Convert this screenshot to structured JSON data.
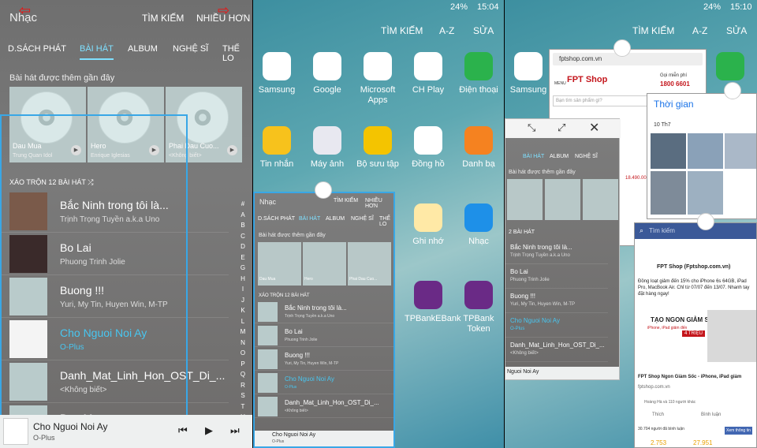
{
  "panel1": {
    "title": "Nhạc",
    "actions": [
      "TÌM KIẾM",
      "NHIỀU HƠN"
    ],
    "tabs": [
      "D.SÁCH PHÁT",
      "BÀI HÁT",
      "ALBUM",
      "NGHỆ SĨ",
      "THỂ LO"
    ],
    "recent_label": "Bài hát được thêm gần đây",
    "albums": [
      {
        "title": "Dau Mua",
        "sub": "Trung Quan Idol"
      },
      {
        "title": "Hero",
        "sub": "Enrique Iglesias"
      },
      {
        "title": "Phai Dau Cuo...",
        "sub": "<Không biết>"
      }
    ],
    "shuffle": "XÁO TRỘN 12 BÀI HÁT",
    "songs": [
      {
        "title": "Bắc Ninh trong tôi là...",
        "artist": "Trịnh Trọng Tuyền a.k.a Uno"
      },
      {
        "title": "Bo Lai",
        "artist": "Phuong Trinh Jolie"
      },
      {
        "title": "Buong !!!",
        "artist": "Yuri, My Tin, Huyen Win, M-TP"
      },
      {
        "title": "Cho Nguoi Noi Ay",
        "artist": "O-Plus"
      },
      {
        "title": "Danh_Mat_Linh_Hon_OST_Di_...",
        "artist": "<Không biết>"
      },
      {
        "title": "Dau Mua",
        "artist": ""
      }
    ],
    "index": [
      "#",
      "A",
      "B",
      "C",
      "D",
      "E",
      "G",
      "H",
      "I",
      "J",
      "K",
      "L",
      "M",
      "N",
      "O",
      "P",
      "Q",
      "R",
      "S",
      "T",
      "U",
      "V",
      "X",
      "Y",
      "Z"
    ],
    "now_playing": {
      "title": "Cho Nguoi Noi Ay",
      "artist": "O-Plus"
    },
    "controls": [
      "⏮",
      "▶",
      "⏭"
    ]
  },
  "panel2": {
    "status": {
      "battery": "24%",
      "time": "15:04"
    },
    "actions": [
      "TÌM KIẾM",
      "A-Z",
      "SỬA"
    ],
    "apps": [
      {
        "label": "Samsung",
        "color": "#ffffff"
      },
      {
        "label": "Google",
        "color": "#ffffff"
      },
      {
        "label": "Microsoft Apps",
        "color": "#ffffff"
      },
      {
        "label": "CH Play",
        "color": "#ffffff"
      },
      {
        "label": "Điện thoại",
        "color": "#2bb24c"
      },
      {
        "label": "Tin nhắn",
        "color": "#f7c21c"
      },
      {
        "label": "Máy ảnh",
        "color": "#e8e8f0"
      },
      {
        "label": "Bộ sưu tập",
        "color": "#f4c400"
      },
      {
        "label": "Đồng hồ",
        "color": "#ffffff"
      },
      {
        "label": "Danh bạ",
        "color": "#f58220"
      },
      {
        "label": "Ghi nhớ",
        "color": "#ffe9a6"
      },
      {
        "label": "Nhạc",
        "color": "#1e90e8"
      },
      {
        "label": "TPBankEBank",
        "color": "#6a2a86"
      },
      {
        "label": "TPBank Token",
        "color": "#6a2a86"
      }
    ],
    "mini_window": {
      "title": "Nhạc",
      "actions": [
        "TÌM KIẾM",
        "NHIỀU HƠN"
      ],
      "tabs": [
        "D.SÁCH PHÁT",
        "BÀI HÁT",
        "ALBUM",
        "NGHỆ SĨ",
        "THỂ LO"
      ],
      "recent": "Bài hát được thêm gần đây",
      "albums": [
        "Dau Mua",
        "Hero",
        "Phai Dau Cuo..."
      ],
      "shuffle": "XÁO TRỘN 12 BÀI HÁT",
      "songs": [
        {
          "title": "Bắc Ninh trong tôi là...",
          "artist": "Trịnh Trọng Tuyền a.k.a Uno"
        },
        {
          "title": "Bo Lai",
          "artist": "Phuong Trinh Jolie"
        },
        {
          "title": "Buong !!!",
          "artist": "Yuri, My Tin, Huyen Win, M-TP"
        },
        {
          "title": "Cho Nguoi Noi Ay",
          "artist": "O-Plus"
        },
        {
          "title": "Danh_Mat_Linh_Hon_OST_Di_...",
          "artist": "<Không biết>"
        }
      ],
      "now_playing": {
        "title": "Cho Nguoi Noi Ay",
        "artist": "O-Plus"
      }
    }
  },
  "panel3": {
    "status": {
      "battery": "24%",
      "time": "15:10"
    },
    "actions": [
      "TÌM KIẾM",
      "A-Z",
      "SỬA"
    ],
    "browser": {
      "url": "fptshop.com.vn",
      "brand": "FPT Shop",
      "menu": "MENU",
      "hotline_label": "Gọi miễn phí",
      "hotline": "1800 6601",
      "search_placeholder": "Bạn tìm sản phẩm gì?",
      "price": "18.490.000"
    },
    "gallery": {
      "title": "Thời gian",
      "date": "10 Th7"
    },
    "music": {
      "tabs": [
        "BÀI HÁT",
        "ALBUM",
        "NGHỆ SĨ"
      ],
      "recent": "Bài hát được thêm gần đây",
      "shuffle": "2 BÀI HÁT",
      "songs": [
        {
          "title": "Bắc Ninh trong tôi là...",
          "artist": "Trịnh Trọng Tuyền a.k.a Uno"
        },
        {
          "title": "Bo Lai",
          "artist": "Phuong Trinh Jolie"
        },
        {
          "title": "Buong !!!",
          "artist": "Yuri, My Tin, Huyen Win, M-TP"
        },
        {
          "title": "Cho Nguoi Noi Ay",
          "artist": "O-Plus"
        },
        {
          "title": "Danh_Mat_Linh_Hon_OST_Di_...",
          "artist": "<Không biết>"
        }
      ],
      "now_playing": "Nguoi Noi Ay"
    },
    "facebook": {
      "search": "Tìm kiếm",
      "page": "FPT Shop (Fptshop.com.vn)",
      "post": "Đồng loạt giảm đến 15% cho iPhone 6s 64GB, iPad Pro, MacBook Air. Chỉ từ 07/07 đến 13/07. Nhanh tay đặt hàng ngay!",
      "ad_title": "TẠO NGON GIẢM SỐC",
      "ad_sub": "iPhone, iPad giảm đến",
      "ad_price": "4 TRIỆU",
      "ad_caption": "FPT Shop Ngon Giảm Sốc - iPhone, iPad giảm",
      "ad_domain": "fptshop.com.vn",
      "reactions": "Hoàng Hà và 110 người khác",
      "actions": [
        "Thích",
        "Bình luận"
      ],
      "ticket": "30.704 người đã bình luận",
      "nums": [
        "2.753",
        "27.951",
        "2.184"
      ],
      "button": "Xem thông tin"
    }
  }
}
